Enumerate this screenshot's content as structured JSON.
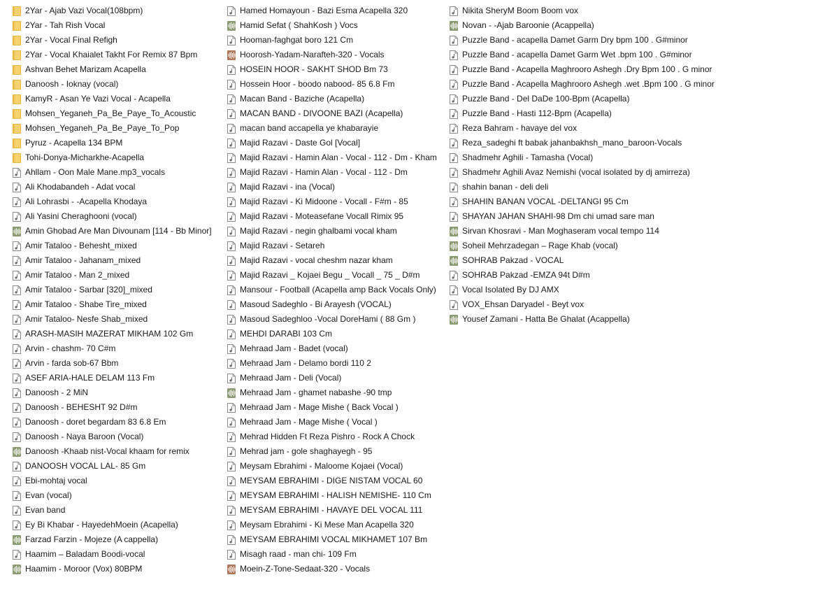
{
  "icon_colors": {
    "folder": "#f7d26f",
    "folder_dark": "#e8b845",
    "mp3": "#ffffff",
    "mp3_border": "#8a8a8a",
    "wav_green": "#8a9a72",
    "wav_brown": "#b0785a"
  },
  "columns": [
    {
      "items": [
        {
          "name": "2Yar - Ajab Vazi Vocal(108bpm)",
          "icon": "folder-icon"
        },
        {
          "name": "2Yar - Tah Rish Vocal",
          "icon": "folder-icon"
        },
        {
          "name": "2Yar - Vocal Final Refigh",
          "icon": "folder-icon"
        },
        {
          "name": "2Yar - Vocal Khaialet Takht For Remix 87 Bpm",
          "icon": "folder-icon"
        },
        {
          "name": "Ashvan Behet Marizam Acapella",
          "icon": "folder-icon"
        },
        {
          "name": "Danoosh - Ioknay (vocal)",
          "icon": "folder-icon"
        },
        {
          "name": "KamyR - Asan Ye Vazi Vocal - Acapella",
          "icon": "folder-icon"
        },
        {
          "name": "Mohsen_Yeganeh_Pa_Be_Paye_To_Acoustic",
          "icon": "folder-icon"
        },
        {
          "name": "Mohsen_Yeganeh_Pa_Be_Paye_To_Pop",
          "icon": "folder-icon"
        },
        {
          "name": "Pyruz - Acapella 134 BPM",
          "icon": "folder-icon"
        },
        {
          "name": "Tohi-Donya-Micharkhe-Acapella",
          "icon": "folder-icon"
        },
        {
          "name": "Ahllam - Oon Male Mane.mp3_vocals",
          "icon": "audio-file-icon"
        },
        {
          "name": "Ali Khodabandeh - Adat vocal",
          "icon": "audio-file-icon"
        },
        {
          "name": "Ali Lohrasbi - -Acapella Khodaya",
          "icon": "audio-file-icon"
        },
        {
          "name": "Ali Yasini Cheraghooni (vocal)",
          "icon": "audio-file-icon"
        },
        {
          "name": "Amin Ghobad Are Man Divounam [114 - Bb Minor]",
          "icon": "wav-file-icon"
        },
        {
          "name": "Amir Tataloo - Behesht_mixed",
          "icon": "audio-file-icon"
        },
        {
          "name": "Amir Tataloo - Jahanam_mixed",
          "icon": "audio-file-icon"
        },
        {
          "name": "Amir Tataloo - Man 2_mixed",
          "icon": "audio-file-icon"
        },
        {
          "name": "Amir Tataloo - Sarbar [320]_mixed",
          "icon": "audio-file-icon"
        },
        {
          "name": "Amir Tataloo - Shabe Tire_mixed",
          "icon": "audio-file-icon"
        },
        {
          "name": "Amir Tataloo- Nesfe Shab_mixed",
          "icon": "audio-file-icon"
        },
        {
          "name": "ARASH-MASIH MAZERAT MIKHAM 102 Gm",
          "icon": "audio-file-icon"
        },
        {
          "name": "Arvin - chashm- 70 C#m",
          "icon": "audio-file-icon"
        },
        {
          "name": "Arvin - farda sob-67 Bbm",
          "icon": "audio-file-icon"
        },
        {
          "name": "ASEF ARIA-HALE DELAM 113 Fm",
          "icon": "audio-file-icon"
        },
        {
          "name": "Danoosh - 2 MiN",
          "icon": "audio-file-icon"
        },
        {
          "name": "Danoosh - BEHESHT 92 D#m",
          "icon": "audio-file-icon"
        },
        {
          "name": "Danoosh - doret begardam 83 6.8 Em",
          "icon": "audio-file-icon"
        },
        {
          "name": "Danoosh - Naya Baroon (Vocal)",
          "icon": "audio-file-icon"
        },
        {
          "name": "Danoosh -Khaab nist-Vocal khaam for remix",
          "icon": "wav-file-icon"
        },
        {
          "name": "DANOOSH VOCAL LAL- 85 Gm",
          "icon": "audio-file-icon"
        },
        {
          "name": "Ebi-mohtaj vocal",
          "icon": "audio-file-icon"
        },
        {
          "name": "Evan (vocal)",
          "icon": "audio-file-icon"
        },
        {
          "name": "Evan band",
          "icon": "audio-file-icon"
        },
        {
          "name": "Ey Bi Khabar - HayedehMoein (Acapella)",
          "icon": "audio-file-icon"
        },
        {
          "name": "Farzad Farzin - Mojeze (A cappella)",
          "icon": "wav-file-icon"
        },
        {
          "name": "Haamim – Baladam Boodi-vocal",
          "icon": "audio-file-icon"
        },
        {
          "name": "Haamim - Moroor (Vox) 80BPM",
          "icon": "wav-file-icon"
        }
      ]
    },
    {
      "items": [
        {
          "name": "Hamed Homayoun - Bazi Esma Acapella 320",
          "icon": "audio-file-icon"
        },
        {
          "name": "Hamid Sefat ( ShahKosh ) Vocs",
          "icon": "wav-file-icon"
        },
        {
          "name": "Hooman-faghgat boro 121 Cm",
          "icon": "audio-file-icon"
        },
        {
          "name": "Hoorosh-Yadam-Narafteh-320 - Vocals",
          "icon": "wav-brown-file-icon"
        },
        {
          "name": "HOSEIN HOOR - SAKHT SHOD Bm 73",
          "icon": "audio-file-icon"
        },
        {
          "name": "Hossein Hoor - boodo nabood- 85 6.8 Fm",
          "icon": "audio-file-icon"
        },
        {
          "name": "Macan Band - Baziche (Acapella)",
          "icon": "audio-file-icon"
        },
        {
          "name": "MACAN BAND - DIVOONE BAZI (Acapella)",
          "icon": "audio-file-icon"
        },
        {
          "name": "macan band accapella ye khabarayie",
          "icon": "audio-file-icon"
        },
        {
          "name": "Majid Razavi - Daste Gol [Vocal]",
          "icon": "audio-file-icon"
        },
        {
          "name": "Majid Razavi - Hamin Alan - Vocal - 112 - Dm - Kham",
          "icon": "audio-file-icon"
        },
        {
          "name": "Majid Razavi - Hamin Alan - Vocal - 112 - Dm",
          "icon": "audio-file-icon"
        },
        {
          "name": "Majid Razavi - ina (Vocal)",
          "icon": "audio-file-icon"
        },
        {
          "name": "Majid Razavi - Ki Midoone - Vocall - F#m - 85",
          "icon": "audio-file-icon"
        },
        {
          "name": "Majid Razavi - Moteasefane Vocall Rimix     95",
          "icon": "audio-file-icon"
        },
        {
          "name": "Majid Razavi - negin ghalbami vocal kham",
          "icon": "audio-file-icon"
        },
        {
          "name": "Majid Razavi - Setareh",
          "icon": "audio-file-icon"
        },
        {
          "name": "Majid Razavi - vocal cheshm nazar kham",
          "icon": "audio-file-icon"
        },
        {
          "name": "Majid Razavi _ Kojaei Begu _ Vocall _ 75 _ D#m",
          "icon": "audio-file-icon"
        },
        {
          "name": "Mansour - Football (Acapella amp Back Vocals Only)",
          "icon": "audio-file-icon"
        },
        {
          "name": "Masoud Sadeghlo - Bi Arayesh (VOCAL)",
          "icon": "audio-file-icon"
        },
        {
          "name": "Masoud Sadeghloo -Vocal DoreHami ( 88 Gm )",
          "icon": "audio-file-icon"
        },
        {
          "name": "MEHDI DARABI 103 Cm",
          "icon": "audio-file-icon"
        },
        {
          "name": "Mehraad Jam - Badet (vocal)",
          "icon": "audio-file-icon"
        },
        {
          "name": "Mehraad Jam - Delamo bordi 110 2",
          "icon": "audio-file-icon"
        },
        {
          "name": "Mehraad Jam - Deli (Vocal)",
          "icon": "audio-file-icon"
        },
        {
          "name": "Mehraad Jam - ghamet nabashe -90 tmp",
          "icon": "wav-file-icon"
        },
        {
          "name": "Mehraad Jam - Mage Mishe ( Back Vocal )",
          "icon": "audio-file-icon"
        },
        {
          "name": "Mehraad Jam - Mage Mishe ( Vocal )",
          "icon": "audio-file-icon"
        },
        {
          "name": "Mehrad Hidden Ft Reza Pishro - Rock A Chock",
          "icon": "audio-file-icon"
        },
        {
          "name": "Mehrad jam - gole shaghayegh - 95",
          "icon": "audio-file-icon"
        },
        {
          "name": "Meysam Ebrahimi  - Maloome Kojaei (Vocal)",
          "icon": "audio-file-icon"
        },
        {
          "name": "MEYSAM EBRAHIMI - DIGE NISTAM VOCAL 60",
          "icon": "audio-file-icon"
        },
        {
          "name": "MEYSAM EBRAHIMI - HALISH NEMISHE- 110 Cm",
          "icon": "audio-file-icon"
        },
        {
          "name": "MEYSAM EBRAHIMI - HAVAYE DEL VOCAL 111",
          "icon": "audio-file-icon"
        },
        {
          "name": "Meysam Ebrahimi - Ki Mese Man Acapella 320",
          "icon": "audio-file-icon"
        },
        {
          "name": "MEYSAM EBRAHIMI VOCAL MIKHAMET 107 Bm",
          "icon": "audio-file-icon"
        },
        {
          "name": "Misagh raad -  man chi- 109 Fm",
          "icon": "audio-file-icon"
        },
        {
          "name": "Moein-Z-Tone-Sedaat-320 - Vocals",
          "icon": "wav-brown-file-icon"
        }
      ]
    },
    {
      "items": [
        {
          "name": "Nikita SheryM Boom Boom vox",
          "icon": "audio-file-icon"
        },
        {
          "name": "Novan - -Ajab Baroonie (Acappella)",
          "icon": "wav-file-icon"
        },
        {
          "name": "Puzzle Band - acapella Damet Garm Dry bpm 100 . G#minor",
          "icon": "audio-file-icon"
        },
        {
          "name": "Puzzle Band - acapella Damet Garm Wet .bpm 100 . G#minor",
          "icon": "audio-file-icon"
        },
        {
          "name": "Puzzle Band - Acapella Maghrooro Ashegh .Dry Bpm 100 . G minor",
          "icon": "audio-file-icon"
        },
        {
          "name": "Puzzle Band - Acapella Maghrooro Ashegh .wet .Bpm 100 . G minor",
          "icon": "audio-file-icon"
        },
        {
          "name": "Puzzle Band - Del DaDe 100-Bpm (Acapella)",
          "icon": "audio-file-icon"
        },
        {
          "name": "Puzzle Band - Hasti 112-Bpm (Acapella)",
          "icon": "audio-file-icon"
        },
        {
          "name": "Reza Bahram - havaye del  vox",
          "icon": "audio-file-icon"
        },
        {
          "name": "Reza_sadeghi ft babak jahanbakhsh_mano_baroon-Vocals",
          "icon": "audio-file-icon"
        },
        {
          "name": "Shadmehr Aghili - Tamasha (Vocal)",
          "icon": "audio-file-icon"
        },
        {
          "name": "Shadmehr Aghili Avaz Nemishi (vocal isolated by dj amirreza)",
          "icon": "audio-file-icon"
        },
        {
          "name": "shahin banan - deli deli",
          "icon": "audio-file-icon"
        },
        {
          "name": "SHAHIN BANAN VOCAL -DELTANGI 95 Cm",
          "icon": "audio-file-icon"
        },
        {
          "name": "SHAYAN JAHAN SHAHI-98 Dm chi umad sare man",
          "icon": "audio-file-icon"
        },
        {
          "name": "Sirvan Khosravi - Man Moghaseram vocal tempo 114",
          "icon": "wav-file-icon"
        },
        {
          "name": "Soheil Mehrzadegan – Rage Khab (vocal)",
          "icon": "wav-file-icon"
        },
        {
          "name": "SOHRAB Pakzad - VOCAL",
          "icon": "wav-file-icon"
        },
        {
          "name": "SOHRAB Pakzad -EMZA 94t D#m",
          "icon": "audio-file-icon"
        },
        {
          "name": "Vocal Isolated By DJ AMX",
          "icon": "audio-file-icon"
        },
        {
          "name": "VOX_Ehsan Daryadel - Beyt vox",
          "icon": "audio-file-icon"
        },
        {
          "name": "Yousef Zamani - Hatta Be Ghalat (Acappella)",
          "icon": "wav-file-icon"
        }
      ]
    }
  ]
}
